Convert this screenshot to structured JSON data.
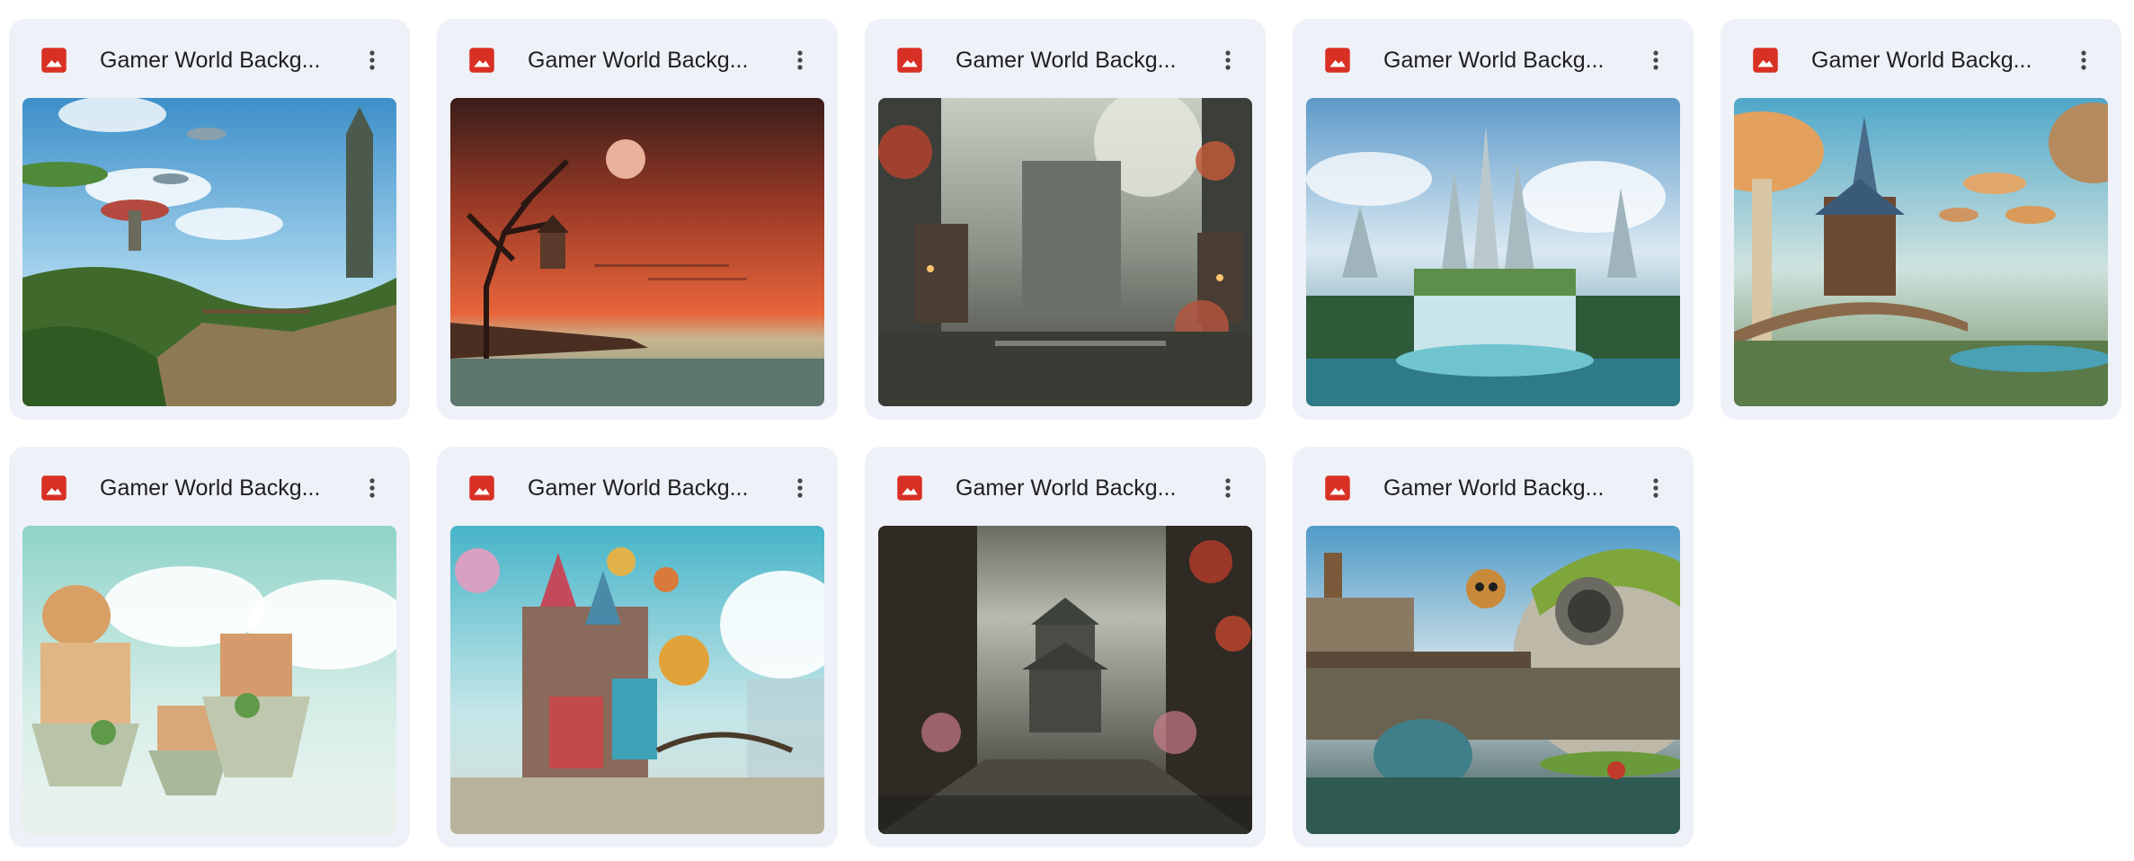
{
  "files": [
    {
      "name": "Gamer World Backg...",
      "icon": "image-file-icon",
      "scene": "floating-mushroom-islands"
    },
    {
      "name": "Gamer World Backg...",
      "icon": "image-file-icon",
      "scene": "red-sunset-dead-trees"
    },
    {
      "name": "Gamer World Backg...",
      "icon": "image-file-icon",
      "scene": "misty-ruins-courtyard"
    },
    {
      "name": "Gamer World Backg...",
      "icon": "image-file-icon",
      "scene": "crystal-castle-waterfall"
    },
    {
      "name": "Gamer World Backg...",
      "icon": "image-file-icon",
      "scene": "mushroom-village-bridge"
    },
    {
      "name": "Gamer World Backg...",
      "icon": "image-file-icon",
      "scene": "floating-island-houses"
    },
    {
      "name": "Gamer World Backg...",
      "icon": "image-file-icon",
      "scene": "whimsical-tower-town"
    },
    {
      "name": "Gamer World Backg...",
      "icon": "image-file-icon",
      "scene": "dark-temple-ruins"
    },
    {
      "name": "Gamer World Backg...",
      "icon": "image-file-icon",
      "scene": "robot-dome-house"
    }
  ],
  "colors": {
    "card_bg": "#eef1f7",
    "icon_red": "#d93025",
    "text": "#1f1f1f",
    "menu_dots": "#444746"
  }
}
